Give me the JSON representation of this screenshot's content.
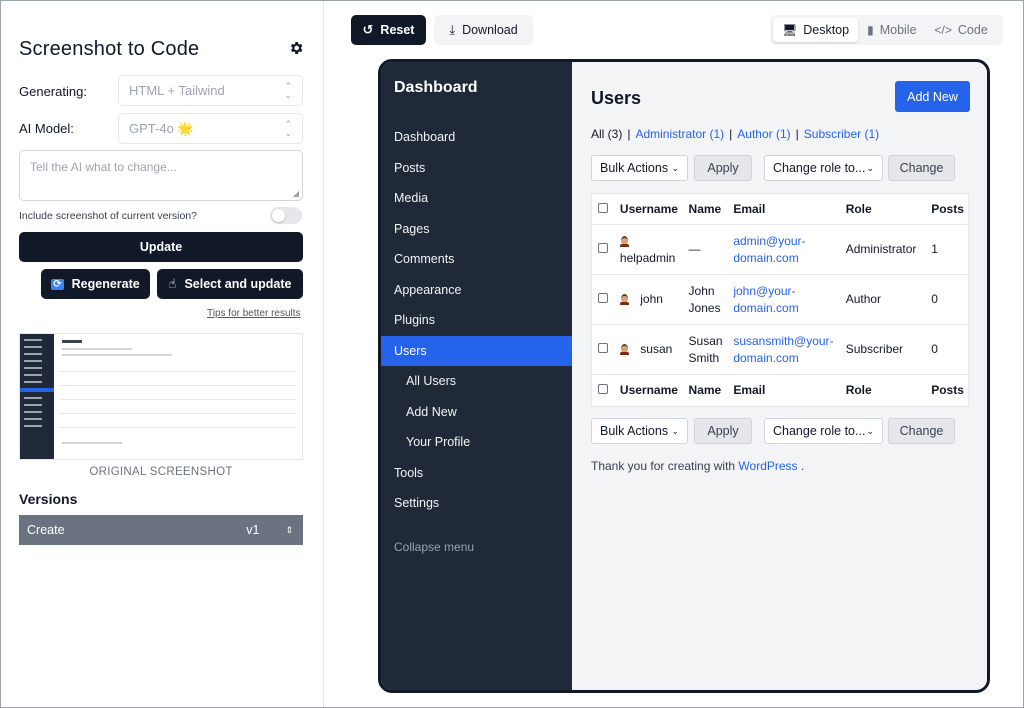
{
  "app": {
    "title": "Screenshot to Code",
    "generating_label": "Generating:",
    "generating_value": "HTML + Tailwind",
    "model_label": "AI Model:",
    "model_value": "GPT-4o 🌟",
    "prompt_placeholder": "Tell the AI what to change...",
    "include_label": "Include screenshot of current version?",
    "include_enabled": false,
    "update_label": "Update",
    "regenerate_label": "Regenerate",
    "select_update_label": "Select and update",
    "tips_label": "Tips for better results",
    "original_caption": "ORIGINAL SCREENSHOT",
    "versions_title": "Versions",
    "version": {
      "name": "Create",
      "tag": "v1"
    }
  },
  "toolbar": {
    "reset_label": "Reset",
    "download_label": "Download",
    "views": [
      {
        "label": "Desktop",
        "active": true
      },
      {
        "label": "Mobile",
        "active": false
      },
      {
        "label": "Code",
        "active": false
      }
    ]
  },
  "preview": {
    "brand": "Dashboard",
    "nav": [
      {
        "label": "Dashboard",
        "active": false,
        "sub": false
      },
      {
        "label": "Posts",
        "active": false,
        "sub": false
      },
      {
        "label": "Media",
        "active": false,
        "sub": false
      },
      {
        "label": "Pages",
        "active": false,
        "sub": false
      },
      {
        "label": "Comments",
        "active": false,
        "sub": false
      },
      {
        "label": "Appearance",
        "active": false,
        "sub": false
      },
      {
        "label": "Plugins",
        "active": false,
        "sub": false
      },
      {
        "label": "Users",
        "active": true,
        "sub": false
      },
      {
        "label": "All Users",
        "active": false,
        "sub": true
      },
      {
        "label": "Add New",
        "active": false,
        "sub": true
      },
      {
        "label": "Your Profile",
        "active": false,
        "sub": true
      },
      {
        "label": "Tools",
        "active": false,
        "sub": false
      },
      {
        "label": "Settings",
        "active": false,
        "sub": false
      }
    ],
    "collapse_label": "Collapse menu",
    "page_title": "Users",
    "add_new_label": "Add New",
    "filters": {
      "all": "All (3)",
      "administrator": "Administrator (1)",
      "author": "Author (1)",
      "subscriber": "Subscriber (1)"
    },
    "bulk_actions": "Bulk Actions",
    "apply_label": "Apply",
    "change_role": "Change role to...",
    "change_label": "Change",
    "columns": [
      "Username",
      "Name",
      "Email",
      "Role",
      "Posts"
    ],
    "rows": [
      {
        "username": "helpadmin",
        "name": "—",
        "email": "admin@your-domain.com",
        "email_l1": "admin@your-",
        "email_l2": "domain.com",
        "role": "Administrator",
        "posts": "1"
      },
      {
        "username": "john",
        "name": "John Jones",
        "name_l1": "John",
        "name_l2": "Jones",
        "email": "john@your-domain.com",
        "email_l1": "john@your-",
        "email_l2": "domain.com",
        "role": "Author",
        "posts": "0"
      },
      {
        "username": "susan",
        "name": "Susan Smith",
        "name_l1": "Susan",
        "name_l2": "Smith",
        "email": "susansmith@your-domain.com",
        "email_l1": "susansmith@your-",
        "email_l2": "domain.com",
        "role": "Subscriber",
        "posts": "0"
      }
    ],
    "thanks_prefix": "Thank you for creating with",
    "thanks_link": "WordPress",
    "thanks_suffix": "."
  }
}
